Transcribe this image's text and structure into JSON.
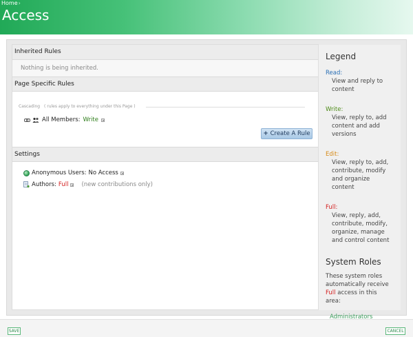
{
  "header": {
    "breadcrumb": "Home",
    "breadcrumb_sep": "›",
    "title": "Access"
  },
  "inherited": {
    "label": "Inherited Rules",
    "message": "Nothing is being inherited."
  },
  "page_rules": {
    "label": "Page Specific Rules",
    "cascading_label": "Cascading",
    "cascading_note": "( rules apply to everything under this Page )",
    "member_label": "All Members:",
    "member_access": "Write",
    "create_button": "Create A Rule",
    "create_icon": "+"
  },
  "settings": {
    "label": "Settings",
    "anon_label": "Anonymous Users:",
    "anon_access": "No Access",
    "authors_label": "Authors:",
    "authors_access": "Full",
    "authors_note": "(new contributions only)"
  },
  "legend": {
    "title": "Legend",
    "items": [
      {
        "name": "Read:",
        "desc": "View and reply to content"
      },
      {
        "name": "Write:",
        "desc": "View, reply to, add content and add versions"
      },
      {
        "name": "Edit:",
        "desc": "View, reply to, add, contribute, modify and organize content"
      },
      {
        "name": "Full:",
        "desc": "View, reply, add, contribute, modify, organize, manage and control content"
      }
    ],
    "colors": {
      "read": "#2a6fb5",
      "write": "#4d8a17",
      "edit": "#d68a17",
      "full": "#d32020"
    }
  },
  "system_roles": {
    "title": "System Roles",
    "desc_before": "These system roles automatically receive",
    "desc_full": "Full",
    "desc_after": "access in this area:",
    "link": "Administrators"
  },
  "footer": {
    "save": "SAVE",
    "cancel": "CANCEL"
  },
  "icons": [
    "chain-icon",
    "users-icon",
    "globe-icon",
    "doc-icon",
    "plus-icon",
    "dropdown-arrow-icon"
  ]
}
